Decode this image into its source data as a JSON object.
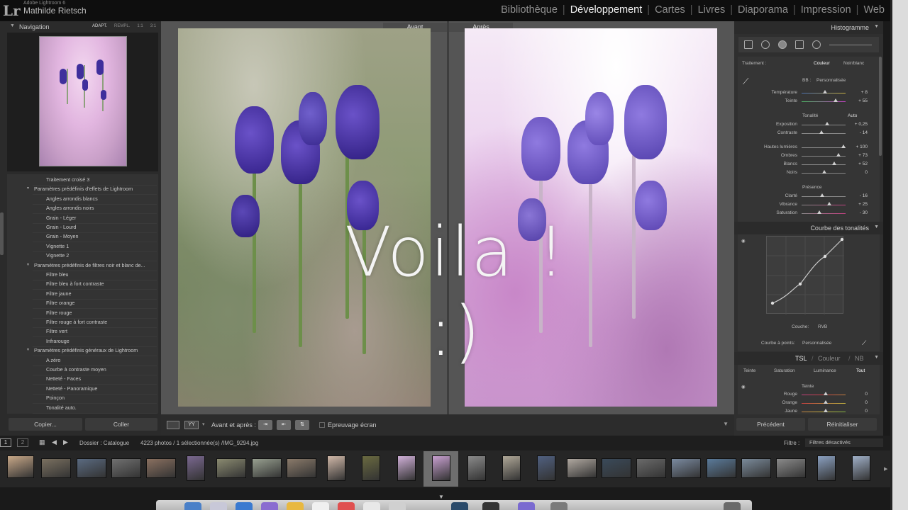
{
  "app": {
    "logo": "Lr",
    "name": "Adobe Lightroom 6",
    "user": "Mathilde Rietsch",
    "modules": [
      "Bibliothèque",
      "Développement",
      "Cartes",
      "Livres",
      "Diaporama",
      "Impression",
      "Web"
    ],
    "active_module": "Développement"
  },
  "navigator": {
    "title": "Navigation",
    "zoom_options": [
      "ADAPT.",
      "REMPL.",
      "1:1",
      "3:1"
    ],
    "zoom_selected": "ADAPT."
  },
  "presets": [
    {
      "label": "Traitement croisé 3",
      "type": "item"
    },
    {
      "label": "Paramètres prédéfinis d'effets de Lightroom",
      "type": "folder"
    },
    {
      "label": "Angles arrondis blancs",
      "type": "item"
    },
    {
      "label": "Angles arrondis noirs",
      "type": "item"
    },
    {
      "label": "Grain - Léger",
      "type": "item"
    },
    {
      "label": "Grain - Lourd",
      "type": "item"
    },
    {
      "label": "Grain - Moyen",
      "type": "item"
    },
    {
      "label": "Vignette 1",
      "type": "item"
    },
    {
      "label": "Vignette 2",
      "type": "item"
    },
    {
      "label": "Paramètres prédéfinis de filtres noir et blanc de...",
      "type": "folder"
    },
    {
      "label": "Filtre bleu",
      "type": "item"
    },
    {
      "label": "Filtre bleu à fort contraste",
      "type": "item"
    },
    {
      "label": "Filtre jaune",
      "type": "item"
    },
    {
      "label": "Filtre orange",
      "type": "item"
    },
    {
      "label": "Filtre rouge",
      "type": "item"
    },
    {
      "label": "Filtre rouge à fort contraste",
      "type": "item"
    },
    {
      "label": "Filtre vert",
      "type": "item"
    },
    {
      "label": "Infrarouge",
      "type": "item"
    },
    {
      "label": "Paramètres prédéfinis généraux de Lightroom",
      "type": "folder"
    },
    {
      "label": "A zéro",
      "type": "item"
    },
    {
      "label": "Courbe à contraste moyen",
      "type": "item"
    },
    {
      "label": "Netteté - Faces",
      "type": "item"
    },
    {
      "label": "Netteté - Panoramique",
      "type": "item"
    },
    {
      "label": "Poinçon",
      "type": "item"
    },
    {
      "label": "Tonalité auto.",
      "type": "item"
    }
  ],
  "left_buttons": {
    "copy": "Copier...",
    "paste": "Coller"
  },
  "view": {
    "before_label": "Avant",
    "after_label": "Après",
    "overlay_text": "Voila ! :)"
  },
  "toolbar": {
    "yy_label": "YY",
    "before_after_label": "Avant et après :",
    "soft_proof_label": "Epreuvage écran"
  },
  "right_panel": {
    "histogram_title": "Histogramme",
    "treatment_label": "Traitement :",
    "treatment_color": "Couleur",
    "treatment_bw": "Noir/blanc",
    "wb_label": "BB :",
    "wb_value": "Personnalisée",
    "temperature": {
      "label": "Température",
      "value": "+ 8"
    },
    "tint": {
      "label": "Teinte",
      "value": "+ 55"
    },
    "tone_label": "Tonalité",
    "auto_label": "Auto",
    "exposure": {
      "label": "Exposition",
      "value": "+ 0,25"
    },
    "contrast": {
      "label": "Contraste",
      "value": "- 14"
    },
    "highlights": {
      "label": "Hautes lumières",
      "value": "+ 100"
    },
    "shadows": {
      "label": "Ombres",
      "value": "+ 73"
    },
    "whites": {
      "label": "Blancs",
      "value": "+ 52"
    },
    "blacks": {
      "label": "Noirs",
      "value": "0"
    },
    "presence_label": "Présence",
    "clarity": {
      "label": "Clarté",
      "value": "- 16"
    },
    "vibrance": {
      "label": "Vibrance",
      "value": "+ 25"
    },
    "saturation": {
      "label": "Saturation",
      "value": "- 30"
    },
    "curve_title": "Courbe des tonalités",
    "channel_label": "Couche:",
    "channel_value": "RVB",
    "point_curve_label": "Courbe à points:",
    "point_curve_value": "Personnalisée",
    "hsl_tabs": [
      "TSL",
      "Couleur",
      "NB"
    ],
    "hsl_subtabs": [
      "Teinte",
      "Saturation",
      "Luminance",
      "Tout"
    ],
    "hsl_section_label": "Teinte",
    "hsl_red": {
      "label": "Rouge",
      "value": "0"
    },
    "hsl_orange": {
      "label": "Orange",
      "value": "0"
    },
    "hsl_yellow": {
      "label": "Jaune",
      "value": "0"
    },
    "prev_button": "Précédent",
    "reset_button": "Réinitialiser"
  },
  "filmstrip_bar": {
    "screen1": "1",
    "screen2": "2",
    "folder_label": "Dossier : Catalogue",
    "count_label": "4223 photos / 1 sélectionnée(s) /IMG_9294.jpg",
    "filter_label": "Filtre :",
    "filter_value": "Filtres désactivés"
  },
  "colors": {
    "panel_bg": "#2b2b2b",
    "active_text": "#f2f2f2",
    "flower_purple": "#3f2f9c"
  }
}
